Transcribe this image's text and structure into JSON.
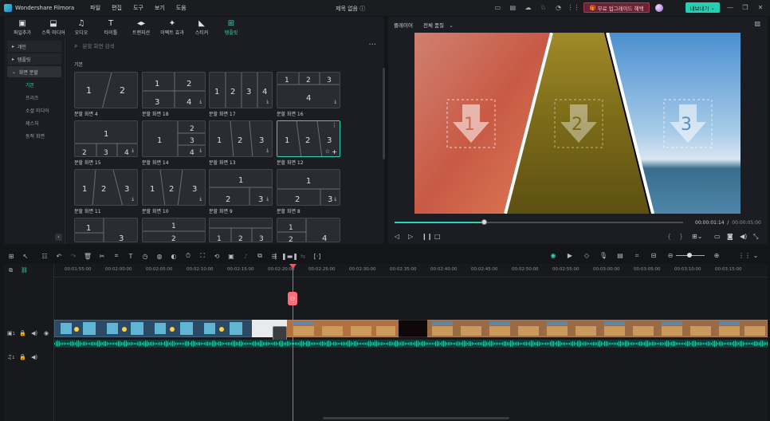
{
  "app": {
    "name": "Wondershare Filmora",
    "project": "제목 없음",
    "promo": "무료 업그레이드 혜택",
    "export": "내보내기"
  },
  "menu": [
    "파일",
    "편집",
    "도구",
    "보기",
    "도움"
  ],
  "ribbon": [
    {
      "icon": "media-icon",
      "glyph": "▣",
      "label": "파일추가"
    },
    {
      "icon": "stock-media-icon",
      "glyph": "⬓",
      "label": "스톡 미디어"
    },
    {
      "icon": "audio-icon",
      "glyph": "♫",
      "label": "오디오"
    },
    {
      "icon": "title-icon",
      "glyph": "T",
      "label": "타이틀"
    },
    {
      "icon": "transition-icon",
      "glyph": "◂▸",
      "label": "트랜지션"
    },
    {
      "icon": "effects-icon",
      "glyph": "✦",
      "label": "이펙트 효과"
    },
    {
      "icon": "sticker-icon",
      "glyph": "◣",
      "label": "스티커"
    },
    {
      "icon": "templates-icon",
      "glyph": "⊞",
      "label": "템플릿"
    }
  ],
  "sidebar": {
    "items": [
      "개인",
      "템플릿"
    ],
    "open": "화면 분할",
    "subitems": [
      "기본",
      "프리즈",
      "소셜 미디어",
      "제스처",
      "동적 화면"
    ]
  },
  "search": {
    "placeholder": "분할 화면 검색"
  },
  "grid": {
    "section": "기본",
    "tiles": [
      "분할 화면 4",
      "분할 화면 18",
      "분할 화면 17",
      "분할 화면 16",
      "분할 화면 15",
      "분할 화면 14",
      "분할 화면 13",
      "분할 화면 12",
      "분할 화면 11",
      "분할 화면 10",
      "분할 화면 9",
      "분할 화면 8"
    ]
  },
  "player": {
    "title": "플레이어",
    "quality": "전체 품질",
    "current": "00:00:01:14",
    "total": "00:00:05:00",
    "progress": 0.31
  },
  "ruler": [
    "00:01:55:00",
    "00:02:00:00",
    "00:02:05:00",
    "00:02:10:00",
    "00:02:15:00",
    "00:02:20:00",
    "00:02:25:00",
    "00:02:30:00",
    "00:02:35:00",
    "00:02:40:00",
    "00:02:45:00",
    "00:02:50:00",
    "00:02:55:00",
    "00:03:00:00",
    "00:03:05:00",
    "00:03:10:00",
    "00:03:15:00"
  ],
  "tracks": {
    "video": "1",
    "audio": "1"
  },
  "colors": {
    "accent": "#2bd4b4",
    "playhead": "#ff4e5f"
  }
}
